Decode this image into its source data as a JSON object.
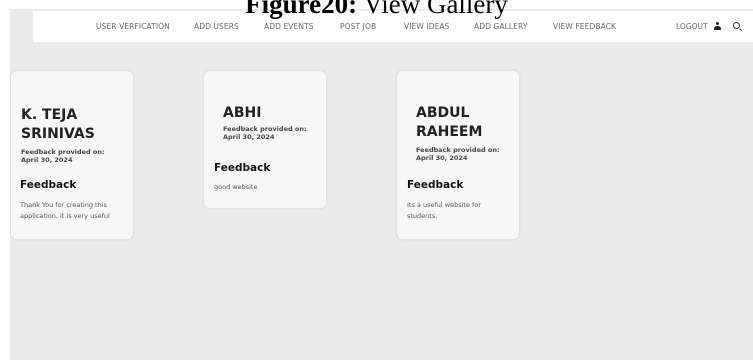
{
  "caption": {
    "prefix": "Figure20:",
    "text": "View Gallery"
  },
  "navbar": {
    "items": [
      {
        "label": "USER VERFICATION"
      },
      {
        "label": "ADD USERS"
      },
      {
        "label": "ADD EVENTS"
      },
      {
        "label": "POST JOB"
      },
      {
        "label": "VIEW IDEAS"
      },
      {
        "label": "ADD GALLERY"
      },
      {
        "label": "VIEW FEEDBACK"
      }
    ],
    "logout_label": "LOGOUT",
    "icons": [
      "user-icon",
      "search-icon"
    ]
  },
  "feedback_cards": [
    {
      "name": "K. TEJA SRINIVAS",
      "provided_label": "Feedback provided on:",
      "date": "April 30, 2024",
      "feedback_heading": "Feedback",
      "feedback_text": "Thank You for creating this application, it is very useful"
    },
    {
      "name": "ABHI",
      "provided_label": "Feedback provided on:",
      "date": "April 30, 2024",
      "feedback_heading": "Feedback",
      "feedback_text": "good website"
    },
    {
      "name": "ABDUL RAHEEM",
      "provided_label": "Feedback provided on:",
      "date": "April 30, 2024",
      "feedback_heading": "Feedback",
      "feedback_text": "Its a useful website for students."
    }
  ]
}
